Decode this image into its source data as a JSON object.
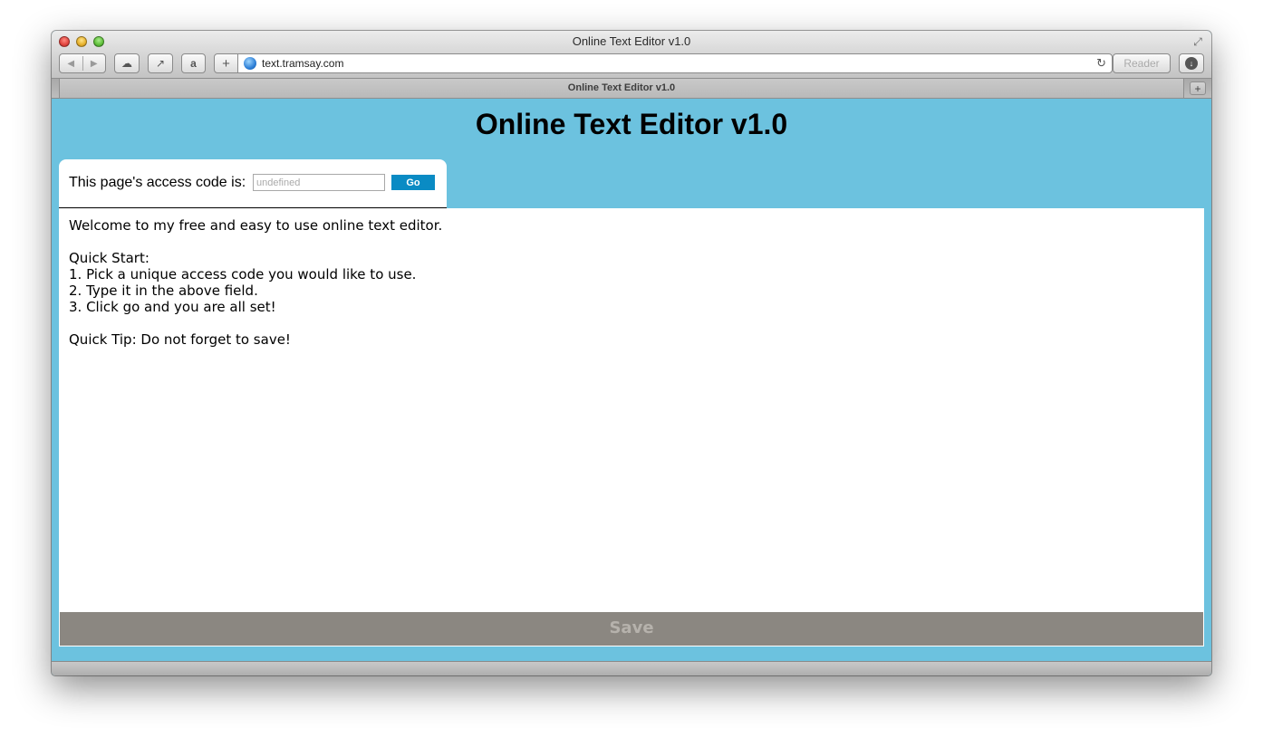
{
  "window": {
    "title": "Online Text Editor v1.0",
    "tab_title": "Online Text Editor v1.0"
  },
  "toolbar": {
    "back_icon": "◀",
    "forward_icon": "▶",
    "icloud_icon": "☁",
    "share_icon": "↗",
    "amazon_icon": "a",
    "add_icon": "+",
    "url": "text.tramsay.com",
    "reload_icon": "↻",
    "reader_label": "Reader",
    "download_icon": "↓",
    "fullscreen_icon": "⤢",
    "new_tab_icon": "+"
  },
  "page": {
    "heading": "Online Text Editor v1.0",
    "access": {
      "label": "This page's access code is:",
      "placeholder": "undefined",
      "go_label": "Go"
    },
    "editor": {
      "lines": [
        "Welcome to my free and easy to use online text editor.",
        "",
        "Quick Start:",
        "1. Pick a unique access code you would like to use.",
        "2. Type it in the above field.",
        "3. Click go and you are all set!",
        "",
        "Quick Tip: Do not forget to save!"
      ]
    },
    "save_label": "Save"
  },
  "colors": {
    "page_background": "#6cc2df",
    "go_button": "#0a8bc4",
    "save_bar": "#8b8781"
  }
}
